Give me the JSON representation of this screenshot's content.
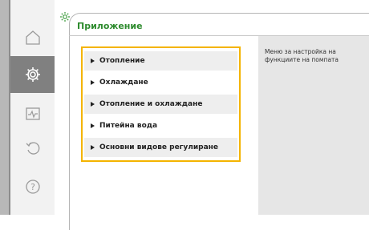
{
  "header": {
    "title": "Приложение"
  },
  "menu": {
    "items": [
      {
        "label": "Отопление"
      },
      {
        "label": "Охлаждане"
      },
      {
        "label": "Отопление и охлаждане"
      },
      {
        "label": "Питейна вода"
      },
      {
        "label": "Основни видове регулиране"
      }
    ]
  },
  "info": {
    "description": "Меню за настройка на функциите на помпата"
  },
  "nav": {
    "items": [
      {
        "icon": "home-icon"
      },
      {
        "icon": "gear-icon",
        "active": true
      },
      {
        "icon": "diagnostics-icon"
      },
      {
        "icon": "restore-icon"
      },
      {
        "icon": "help-icon"
      }
    ]
  },
  "colors": {
    "title_green": "#2e8b2e",
    "highlight_yellow": "#f4b400",
    "active_nav": "#808080",
    "info_panel": "#e6e6e6"
  }
}
